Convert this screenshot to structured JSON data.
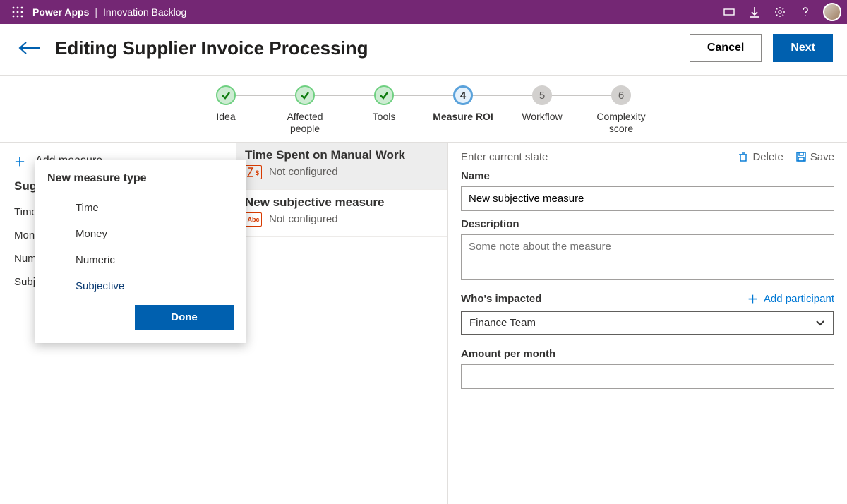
{
  "topbar": {
    "app": "Power Apps",
    "separator": "|",
    "title": "Innovation Backlog"
  },
  "header": {
    "title": "Editing Supplier Invoice Processing",
    "cancel": "Cancel",
    "next": "Next"
  },
  "steps": [
    {
      "label": "Idea",
      "state": "done",
      "num": ""
    },
    {
      "label": "Affected people",
      "state": "done",
      "num": ""
    },
    {
      "label": "Tools",
      "state": "done",
      "num": ""
    },
    {
      "label": "Measure ROI",
      "state": "active",
      "num": "4"
    },
    {
      "label": "Workflow",
      "state": "pending",
      "num": "5"
    },
    {
      "label": "Complexity score",
      "state": "pending",
      "num": "6"
    }
  ],
  "leftcol": {
    "add": "Add measure",
    "suggested_header": "Suggested",
    "suggested": [
      "Time",
      "Money",
      "Numeric",
      "Subjective"
    ]
  },
  "popover": {
    "title": "New measure type",
    "options": [
      "Time",
      "Money",
      "Numeric",
      "Subjective"
    ],
    "selected": "Subjective",
    "done": "Done"
  },
  "measures": [
    {
      "title": "Time Spent on Manual Work",
      "status": "Not configured",
      "icon": "time",
      "selected": true
    },
    {
      "title": "New subjective measure",
      "status": "Not configured",
      "icon": "abc",
      "selected": false
    }
  ],
  "form": {
    "state_title": "Enter current state",
    "delete": "Delete",
    "save": "Save",
    "name_label": "Name",
    "name_value": "New subjective measure",
    "desc_label": "Description",
    "desc_placeholder": "Some note about the measure",
    "who_label": "Who's impacted",
    "add_participant": "Add participant",
    "who_value": "Finance Team",
    "amount_label": "Amount per month",
    "amount_value": ""
  }
}
